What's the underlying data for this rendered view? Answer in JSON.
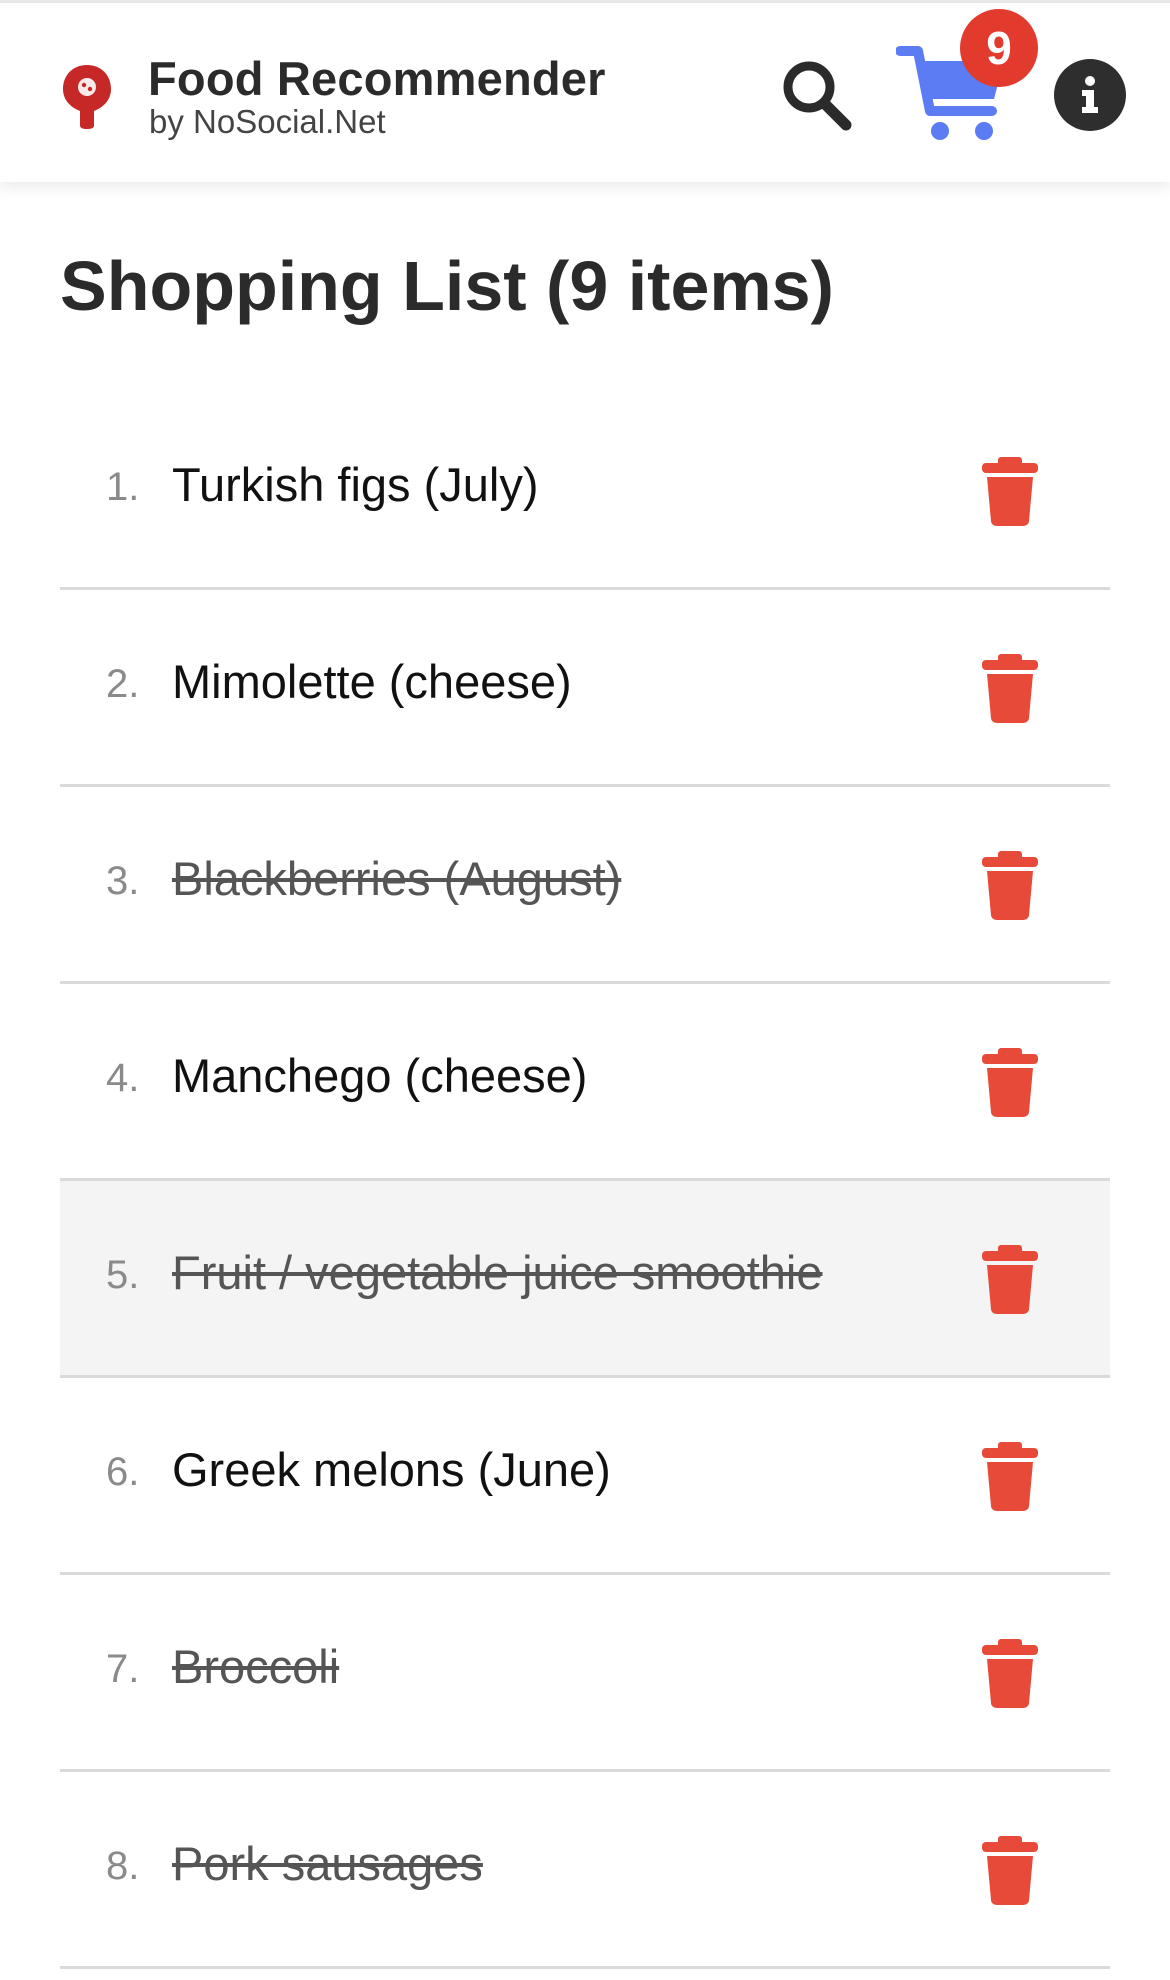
{
  "header": {
    "title": "Food Recommender",
    "subtitle": "by NoSocial.Net",
    "cart_count": "9",
    "icons": {
      "logo": "map-pin-logo",
      "search": "search-icon",
      "cart": "shopping-cart-icon",
      "info": "info-icon"
    }
  },
  "page": {
    "title": "Shopping List (9 items)"
  },
  "list": {
    "items": [
      {
        "number": "1.",
        "label": "Turkish figs (July)",
        "checked": false
      },
      {
        "number": "2.",
        "label": "Mimolette (cheese)",
        "checked": false
      },
      {
        "number": "3.",
        "label": "Blackberries (August)",
        "checked": true
      },
      {
        "number": "4.",
        "label": "Manchego (cheese)",
        "checked": false
      },
      {
        "number": "5.",
        "label": "Fruit / vegetable juice smoothie",
        "checked": true
      },
      {
        "number": "6.",
        "label": "Greek melons (June)",
        "checked": false
      },
      {
        "number": "7.",
        "label": "Broccoli",
        "checked": true
      },
      {
        "number": "8.",
        "label": "Pork sausages",
        "checked": true
      }
    ],
    "delete_icon": "trash-icon"
  },
  "colors": {
    "accent": "#5b7cf2",
    "danger": "#e84a3a",
    "badge": "#e23b2e",
    "logo": "#c62828"
  }
}
